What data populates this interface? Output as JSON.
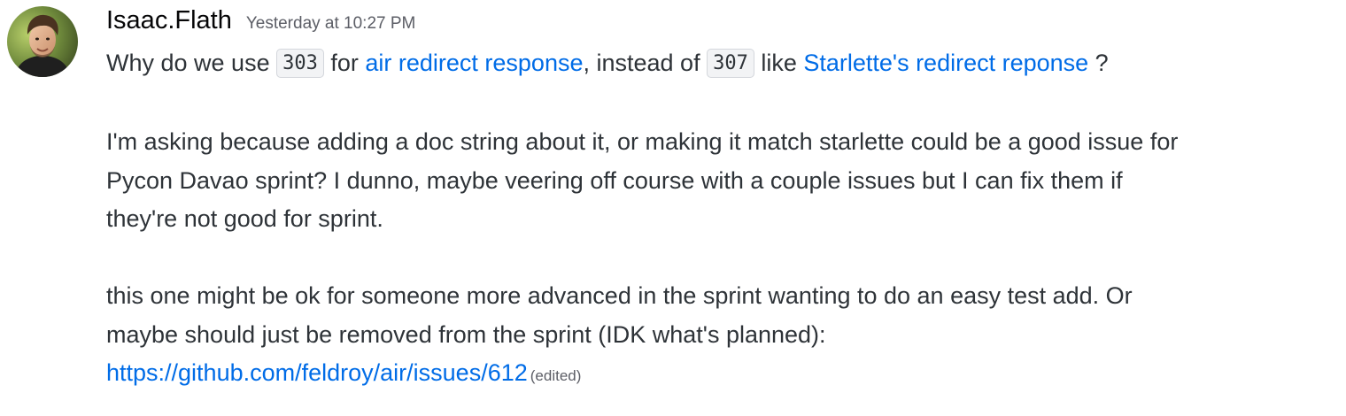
{
  "author": {
    "username": "Isaac.Flath",
    "timestamp": "Yesterday at 10:27 PM"
  },
  "message": {
    "p1": {
      "t1": "Why do we use ",
      "code1": "303",
      "t2": " for ",
      "link1": "air redirect response",
      "t3": ", instead of ",
      "code2": "307",
      "t4": " like ",
      "link2": "Starlette's redirect reponse",
      "t5": " ?"
    },
    "p2": {
      "line1": "I'm asking because adding a doc string about it, or making it match starlette could be a good issue for",
      "line2": "Pycon Davao sprint?  I dunno, maybe veering off course with a couple issues but I can fix them if",
      "line3": "they're not good for sprint."
    },
    "p3": {
      "line1": "this one might be ok for someone more advanced in the sprint wanting to do an easy test add.  Or",
      "line2": "maybe should just be removed from the sprint (IDK what's planned):",
      "link": "https://github.com/feldroy/air/issues/612",
      "edited": "(edited)"
    }
  },
  "colors": {
    "link": "#006ce7",
    "text": "#2e3338",
    "username": "#060607",
    "muted": "#5c5e66"
  }
}
